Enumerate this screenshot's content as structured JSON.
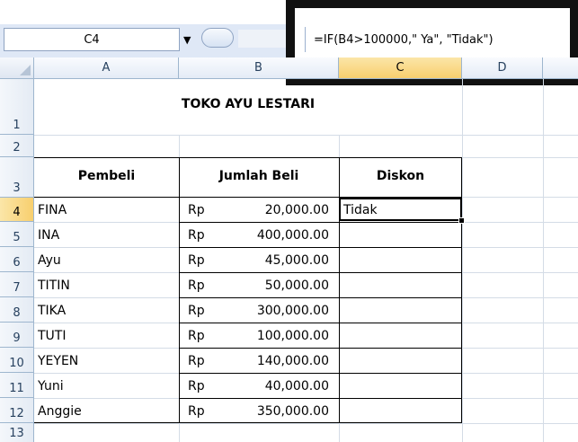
{
  "name_box": "C4",
  "formula": "=IF(B4>100000,\" Ya\", \"Tidak\")",
  "columns": [
    "A",
    "B",
    "C",
    "D"
  ],
  "rows": [
    "1",
    "2",
    "3",
    "4",
    "5",
    "6",
    "7",
    "8",
    "9",
    "10",
    "11",
    "12",
    "13"
  ],
  "title": "TOKO AYU LESTARI",
  "headers": {
    "buyer": "Pembeli",
    "amount": "Jumlah Beli",
    "discount": "Diskon"
  },
  "currency": "Rp",
  "data": [
    {
      "name": "FINA",
      "amount": "20,000.00",
      "discount": "Tidak"
    },
    {
      "name": "INA",
      "amount": "400,000.00",
      "discount": ""
    },
    {
      "name": "Ayu",
      "amount": "45,000.00",
      "discount": ""
    },
    {
      "name": "TITIN",
      "amount": "50,000.00",
      "discount": ""
    },
    {
      "name": "TIKA",
      "amount": "300,000.00",
      "discount": ""
    },
    {
      "name": "TUTI",
      "amount": "100,000.00",
      "discount": ""
    },
    {
      "name": "YEYEN",
      "amount": "140,000.00",
      "discount": ""
    },
    {
      "name": "Yuni",
      "amount": "40,000.00",
      "discount": ""
    },
    {
      "name": "Anggie",
      "amount": "350,000.00",
      "discount": ""
    }
  ]
}
